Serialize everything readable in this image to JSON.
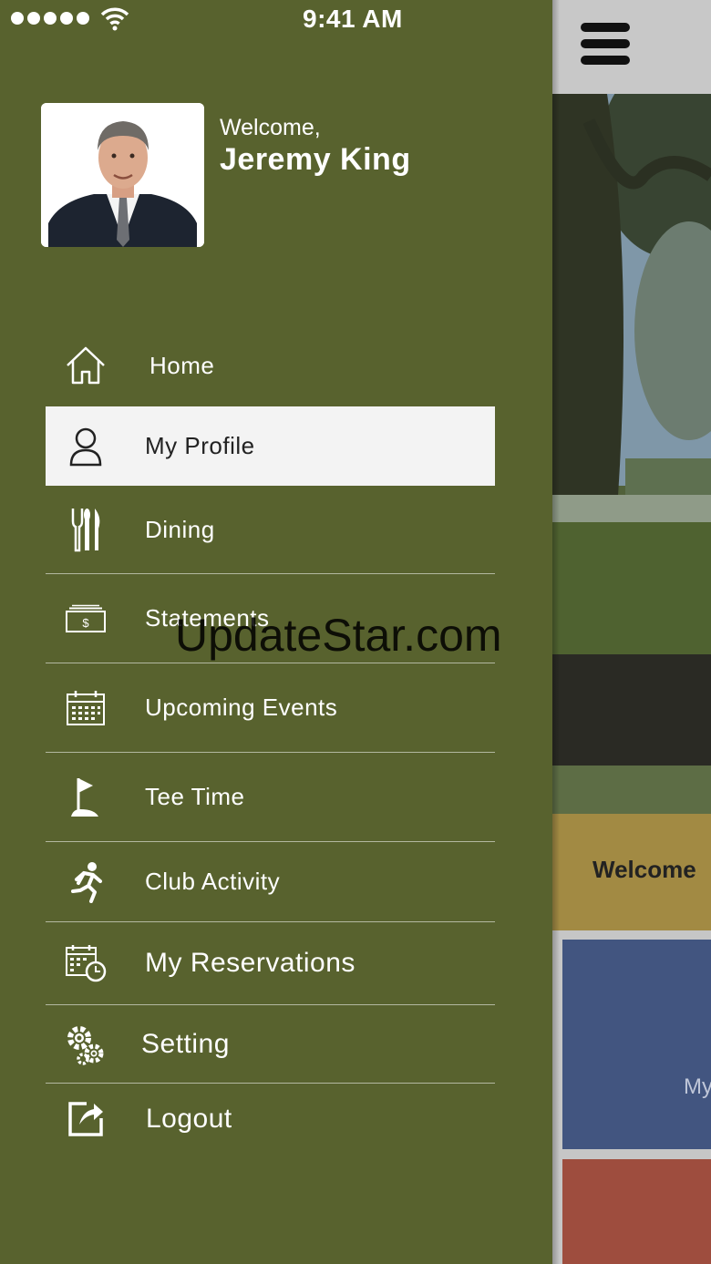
{
  "status_bar": {
    "time": "9:41 AM"
  },
  "profile": {
    "greeting": "Welcome,",
    "name": "Jeremy King"
  },
  "menu": {
    "items": [
      {
        "label": "Home",
        "icon": "home-icon"
      },
      {
        "label": "My Profile",
        "icon": "user-icon",
        "active": true
      },
      {
        "label": "Dining",
        "icon": "dining-icon"
      },
      {
        "label": "Statements",
        "icon": "statements-icon"
      },
      {
        "label": "Upcoming Events",
        "icon": "calendar-icon"
      },
      {
        "label": "Tee Time",
        "icon": "golf-flag-icon"
      },
      {
        "label": "Club Activity",
        "icon": "running-icon"
      },
      {
        "label": "My Reservations",
        "icon": "calendar-clock-icon"
      },
      {
        "label": "Setting",
        "icon": "gears-icon"
      },
      {
        "label": "Logout",
        "icon": "logout-icon"
      }
    ]
  },
  "background_screen": {
    "welcome_label": "Welcome",
    "tile_label": "My"
  },
  "watermark": "UpdateStar.com",
  "colors": {
    "drawer": "#58622e",
    "active_item": "#f3f3f3",
    "gold_band": "#a28a43",
    "blue_tile": "#425580",
    "red_tile": "#9e4d3e"
  }
}
